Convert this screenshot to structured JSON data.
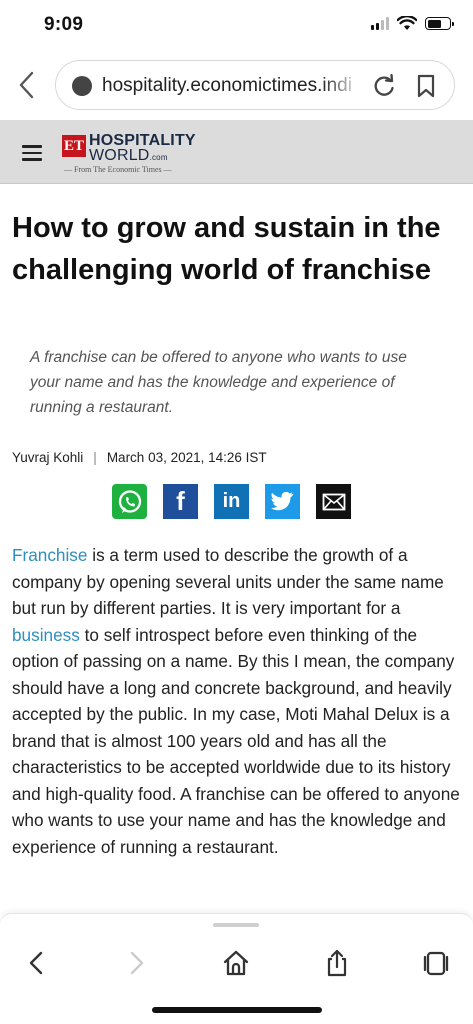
{
  "status_bar": {
    "time": "9:09"
  },
  "browser": {
    "url": "hospitality.economictimes.indi"
  },
  "site": {
    "logo_et": "ET",
    "logo_line1": "HOSPITALITY",
    "logo_line2": "WORLD",
    "logo_suffix": ".com",
    "logo_tagline": "— From The Economic Times —"
  },
  "article": {
    "title": "How to grow and sustain in the challenging world of franchise",
    "summary": "A franchise can be offered to anyone who wants to use your name and has the knowledge and experience of running a restaurant.",
    "author": "Yuvraj Kohli",
    "separator": "|",
    "date": "March 03, 2021, 14:26 IST",
    "share_icons": [
      "whatsapp-icon",
      "facebook-icon",
      "linkedin-icon",
      "twitter-icon",
      "mail-icon"
    ],
    "body": {
      "link1": "Franchise",
      "text1": " is a term used to describe the growth of a company by opening several units under the same name but run by different parties. It is very important for a ",
      "link2": "business",
      "text2": " to self introspect before even thinking of the option of passing on a name. By this I mean, the company should have a long and concrete background, and heavily accepted by the public. In my case, Moti Mahal Delux is a brand that is almost 100 years old and has all the characteristics to be accepted worldwide due to its history and high-quality food. A franchise can be offered to anyone who wants to use your name and has the knowledge and experience of running a restaurant."
    }
  },
  "toolbar": {
    "icons": [
      "back-icon",
      "forward-icon",
      "home-icon",
      "share-icon",
      "tabs-icon"
    ]
  }
}
